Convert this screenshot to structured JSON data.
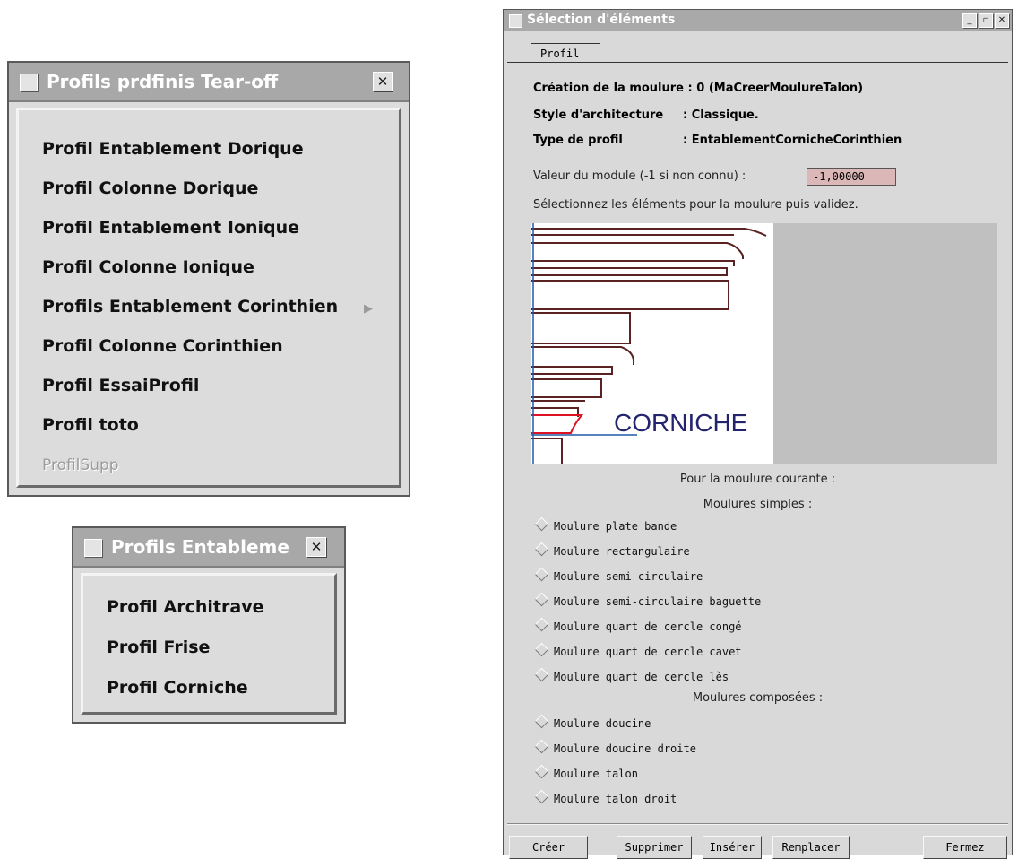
{
  "menu1": {
    "title": "Profils prdfinis Tear-off",
    "close_glyph": "✕",
    "items": [
      "Profil Entablement Dorique",
      "Profil Colonne Dorique",
      "Profil Entablement Ionique",
      "Profil Colonne Ionique",
      "Profils Entablement Corinthien",
      "Profil Colonne Corinthien",
      "Profil EssaiProfil",
      "Profil toto",
      "ProfilSupp"
    ],
    "submenu_arrow": "▶"
  },
  "menu2": {
    "title": "Profils Entableme",
    "close_glyph": "✕",
    "items": [
      "Profil Architrave",
      "Profil Frise",
      "Profil Corniche"
    ]
  },
  "dialog": {
    "title": "Sélection d'éléments",
    "window_buttons": [
      "_",
      "▫",
      "✕"
    ],
    "tab": "Profil",
    "creation": "Création de la moulure : 0 (MaCreerMoulureTalon)",
    "style_label": "Style d'architecture",
    "style_value": ": Classique.",
    "type_label": "Type de profil",
    "type_value": ": EntablementCornicheCorinthien",
    "module_label": "Valeur du module (-1 si non connu) :",
    "module_value": "-1,00000",
    "instruction": "Sélectionnez les éléments pour la moulure puis validez.",
    "preview_label": "CORNICHE",
    "current_label": "Pour la moulure courante :",
    "simple_header": "Moulures simples :",
    "simple": [
      "Moulure plate bande",
      "Moulure rectangulaire",
      "Moulure semi-circulaire",
      "Moulure semi-circulaire baguette",
      "Moulure quart de cercle congé",
      "Moulure quart de cercle cavet",
      "Moulure quart de cercle lès"
    ],
    "composed_header": "Moulures composées :",
    "composed": [
      "Moulure doucine",
      "Moulure doucine droite",
      "Moulure talon",
      "Moulure talon droit"
    ],
    "buttons": {
      "create": "Créer",
      "delete": "Supprimer",
      "insert": "Insérer",
      "replace": "Remplacer",
      "close": "Fermez"
    }
  }
}
